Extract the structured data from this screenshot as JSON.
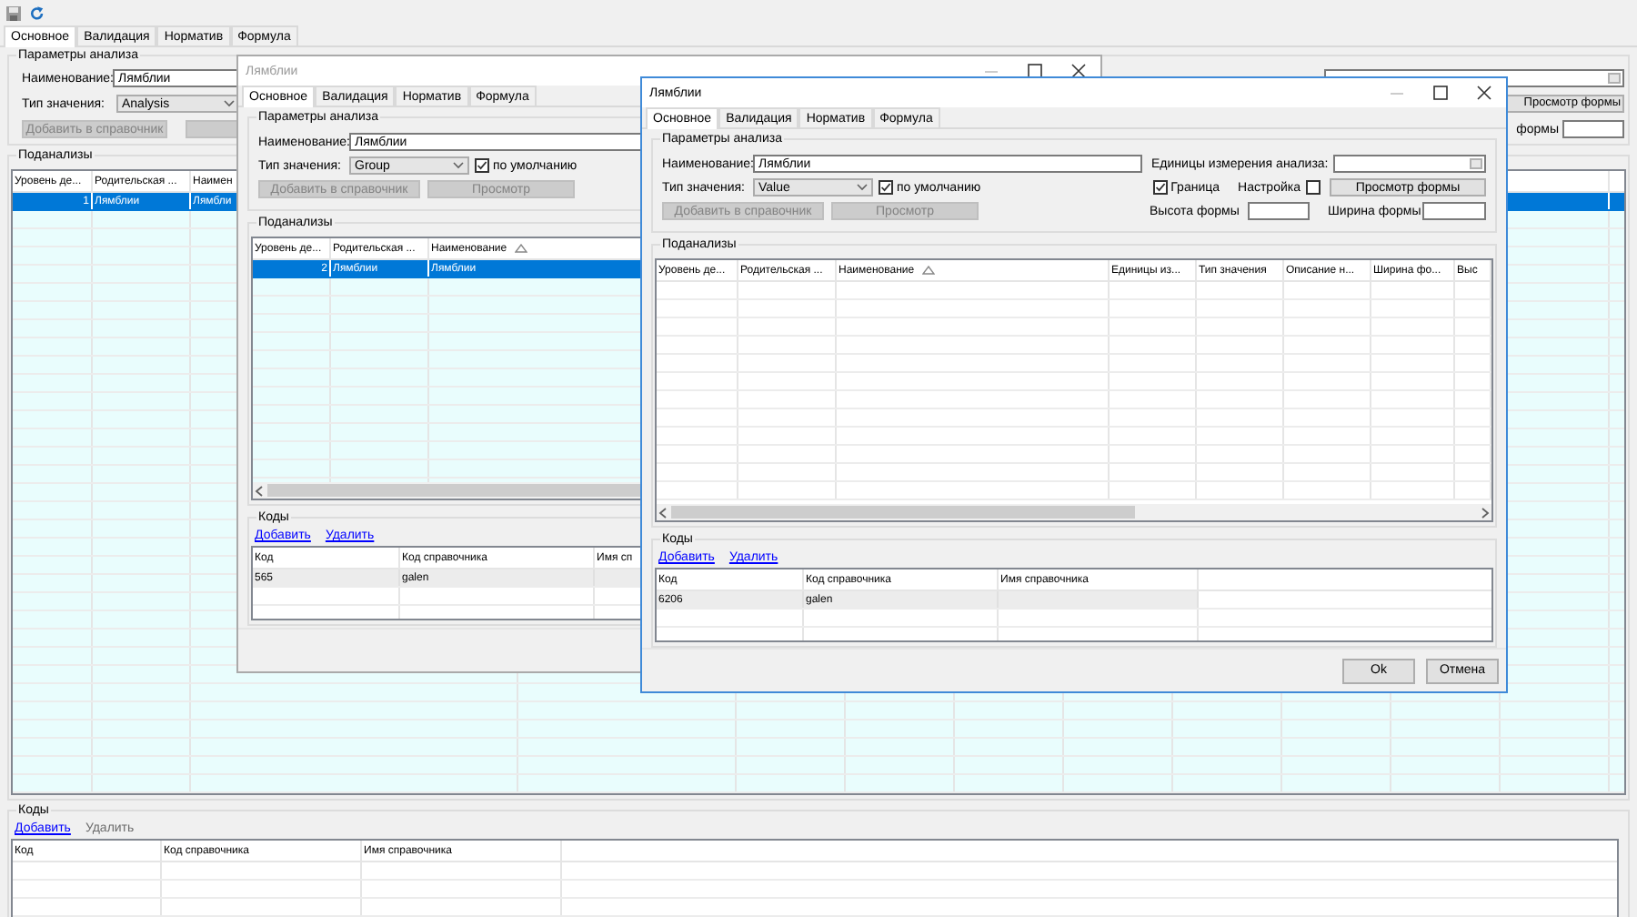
{
  "main_window": {
    "tabs": [
      {
        "label": "Основное",
        "selected": true
      },
      {
        "label": "Валидация",
        "selected": false
      },
      {
        "label": "Норматив",
        "selected": false
      },
      {
        "label": "Формула",
        "selected": false
      }
    ],
    "parameters": {
      "title": "Параметры анализа",
      "name_label": "Наименование:",
      "name_value": "Лямблии",
      "type_label": "Тип значения:",
      "type_value": "Analysis",
      "add_button": {
        "label": "Добавить в справочник",
        "disabled": true
      },
      "preview_form_button": "Просмотр формы",
      "form_width_label": "формы"
    },
    "subanalyses": {
      "title": "Поданализы",
      "columns": [
        {
          "label": "Уровень де..."
        },
        {
          "label": "Родительская ..."
        },
        {
          "label": "Наимен"
        }
      ],
      "rows": [
        {
          "cells": [
            "1",
            "Лямблии",
            "Лямбли"
          ],
          "selected": true
        }
      ]
    },
    "codes": {
      "title": "Коды",
      "links": [
        {
          "label": "Добавить",
          "disabled": false
        },
        {
          "label": "Удалить",
          "disabled": true
        }
      ],
      "columns": [
        {
          "label": "Код"
        },
        {
          "label": "Код справочника"
        },
        {
          "label": "Имя справочника"
        }
      ]
    }
  },
  "dialogs": [
    {
      "title": "Лямблии",
      "active": false,
      "tabs": [
        {
          "label": "Основное",
          "selected": true
        },
        {
          "label": "Валидация",
          "selected": false
        },
        {
          "label": "Норматив",
          "selected": false
        },
        {
          "label": "Формула",
          "selected": false
        }
      ],
      "parameters": {
        "title": "Параметры анализа",
        "name_label": "Наименование:",
        "name_value": "Лямблии",
        "type_label": "Тип значения:",
        "type_value": "Group",
        "default_checkbox": {
          "label": "по умолчанию",
          "checked": true
        },
        "add_button": {
          "label": "Добавить в справочник",
          "disabled": true
        },
        "preview_button": {
          "label": "Просмотр",
          "disabled": true
        }
      },
      "subanalyses": {
        "title": "Поданализы",
        "columns": [
          {
            "label": "Уровень де..."
          },
          {
            "label": "Родительская ..."
          },
          {
            "label": "Наименование",
            "sorted": true
          }
        ],
        "rows": [
          {
            "cells": [
              "2",
              "Лямблии",
              "Лямблии"
            ],
            "selected": true
          }
        ]
      },
      "codes": {
        "title": "Коды",
        "links": [
          {
            "label": "Добавить",
            "disabled": false
          },
          {
            "label": "Удалить",
            "disabled": false
          }
        ],
        "columns": [
          {
            "label": "Код"
          },
          {
            "label": "Код справочника"
          },
          {
            "label": "Имя сп"
          }
        ],
        "rows": [
          {
            "cells": [
              "565",
              "galen",
              ""
            ],
            "selected": false
          }
        ]
      }
    },
    {
      "title": "Лямблии",
      "active": true,
      "tabs": [
        {
          "label": "Основное",
          "selected": true
        },
        {
          "label": "Валидация",
          "selected": false
        },
        {
          "label": "Норматив",
          "selected": false
        },
        {
          "label": "Формула",
          "selected": false
        }
      ],
      "parameters": {
        "title": "Параметры анализа",
        "name_label": "Наименование:",
        "name_value": "Лямблии",
        "units_label": "Единицы измерения анализа:",
        "type_label": "Тип значения:",
        "type_value": "Value",
        "default_checkbox": {
          "label": "по умолчанию",
          "checked": true
        },
        "border_checkbox": {
          "label": "Граница",
          "checked": true
        },
        "setup_checkbox": {
          "label": "Настройка",
          "checked": false
        },
        "preview_form_button": "Просмотр формы",
        "add_button": {
          "label": "Добавить в справочник",
          "disabled": true
        },
        "preview_button": {
          "label": "Просмотр",
          "disabled": true
        },
        "height_label": "Высота формы",
        "width_label": "Ширина формы"
      },
      "subanalyses": {
        "title": "Поданализы",
        "columns": [
          {
            "label": "Уровень де..."
          },
          {
            "label": "Родительская ..."
          },
          {
            "label": "Наименование",
            "sorted": true
          },
          {
            "label": "Единицы из..."
          },
          {
            "label": "Тип значения"
          },
          {
            "label": "Описание н..."
          },
          {
            "label": "Ширина фо..."
          },
          {
            "label": "Выс"
          }
        ]
      },
      "codes": {
        "title": "Коды",
        "links": [
          {
            "label": "Добавить",
            "disabled": false
          },
          {
            "label": "Удалить",
            "disabled": false
          }
        ],
        "columns": [
          {
            "label": "Код"
          },
          {
            "label": "Код справочника"
          },
          {
            "label": "Имя справочника"
          }
        ],
        "rows": [
          {
            "cells": [
              "6206",
              "galen",
              ""
            ],
            "selected": false
          }
        ]
      },
      "buttons": [
        "Ok",
        "Отмена"
      ]
    }
  ]
}
